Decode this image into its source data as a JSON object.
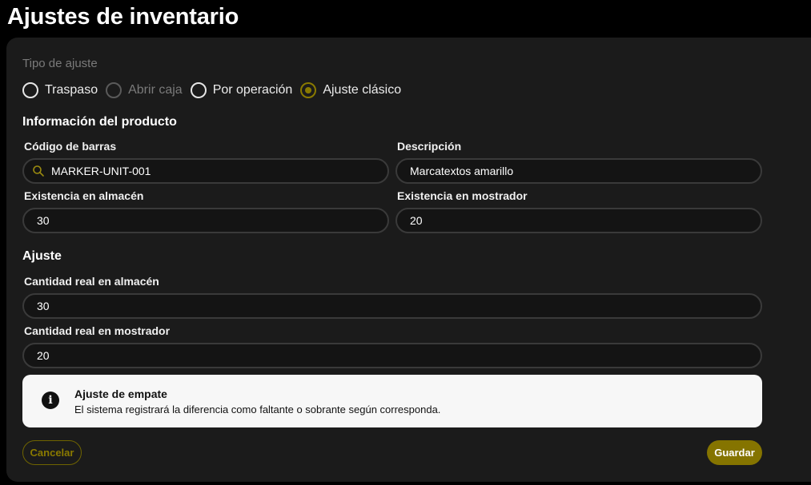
{
  "page": {
    "title": "Ajustes de inventario"
  },
  "adjustment_type": {
    "label": "Tipo de ajuste",
    "options": [
      {
        "label": "Traspaso",
        "state": "unselected"
      },
      {
        "label": "Abrir caja",
        "state": "disabled"
      },
      {
        "label": "Por operación",
        "state": "unselected"
      },
      {
        "label": "Ajuste clásico",
        "state": "selected"
      }
    ]
  },
  "product_info": {
    "title": "Información del producto",
    "barcode": {
      "label": "Código de barras",
      "value": "MARKER-UNIT-001"
    },
    "description": {
      "label": "Descripción",
      "value": "Marcatextos amarillo"
    },
    "warehouse_stock": {
      "label": "Existencia en almacén",
      "value": "30"
    },
    "counter_stock": {
      "label": "Existencia en mostrador",
      "value": "20"
    }
  },
  "adjustment": {
    "title": "Ajuste",
    "real_warehouse": {
      "label": "Cantidad real en almacén",
      "value": "30"
    },
    "real_counter": {
      "label": "Cantidad real en mostrador",
      "value": "20"
    }
  },
  "notice": {
    "icon": "info-icon",
    "title": "Ajuste de empate",
    "text": "El sistema registrará la diferencia como faltante o sobrante según corresponda."
  },
  "actions": {
    "cancel_label": "Cancelar",
    "save_label": "Guardar"
  },
  "colors": {
    "accent": "#857400",
    "card_bg": "#1b1b1b",
    "page_bg": "#000000",
    "notice_bg": "#f7f7f7"
  }
}
